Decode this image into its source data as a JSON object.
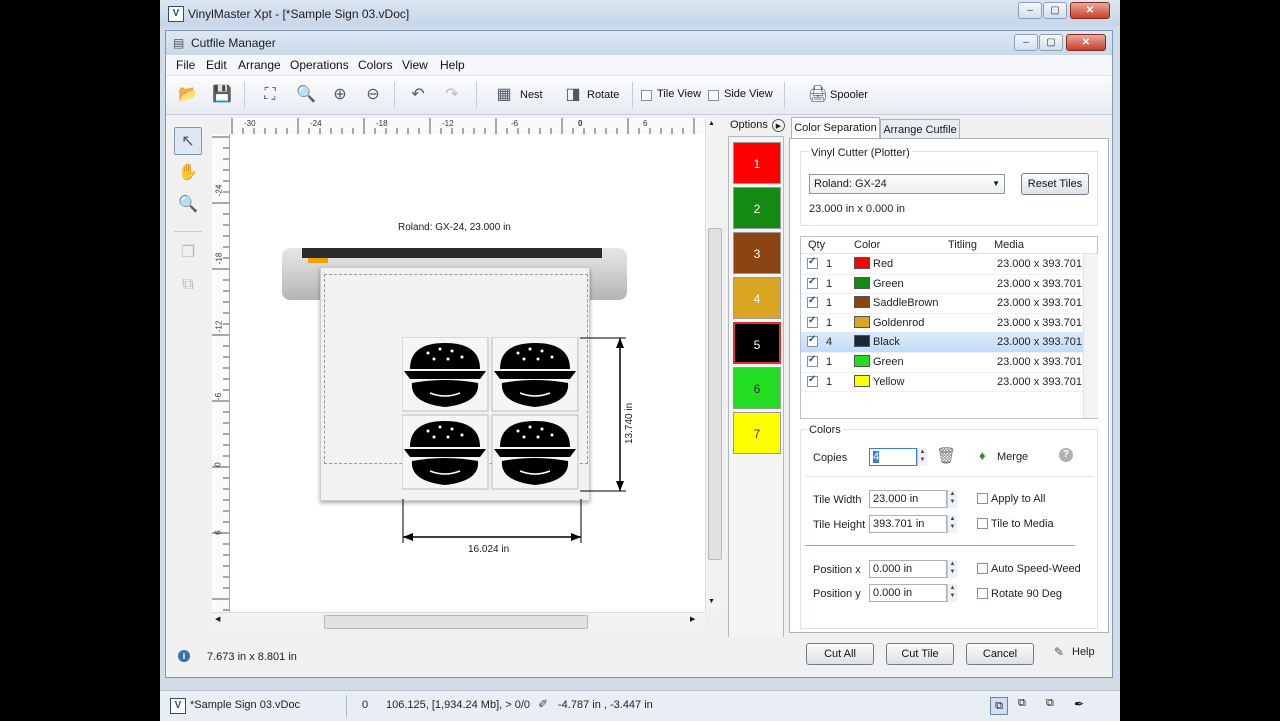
{
  "app": {
    "title": "VinylMaster Xpt - [*Sample Sign 03.vDoc]",
    "icon_letter": "V"
  },
  "dialog": {
    "title": "Cutfile Manager"
  },
  "menu": [
    "File",
    "Edit",
    "Arrange",
    "Operations",
    "Colors",
    "View",
    "Help"
  ],
  "toolbar": {
    "nest_label": "Nest",
    "rotate_label": "Rotate",
    "tile_view_label": "Tile View",
    "side_view_label": "Side View",
    "spooler_label": "Spooler"
  },
  "ruler": {
    "top": [
      "-30",
      "-24",
      "-18",
      "-12",
      "-6",
      "0",
      "6"
    ],
    "left": [
      "-24",
      "-18",
      "-12",
      "-6",
      "0",
      "6"
    ]
  },
  "canvas": {
    "plotter_label": "Roland: GX-24, 23.000 in",
    "height_dim": "13.740 in",
    "width_dim": "16.024 in"
  },
  "options_label": "Options",
  "swatches": [
    {
      "num": "1",
      "color": "#ff0000"
    },
    {
      "num": "2",
      "color": "#138a12"
    },
    {
      "num": "3",
      "color": "#8b4513"
    },
    {
      "num": "4",
      "color": "#daa520"
    },
    {
      "num": "5",
      "color": "#000000"
    },
    {
      "num": "6",
      "color": "#22dd22"
    },
    {
      "num": "7",
      "color": "#ffff00"
    }
  ],
  "tabs": {
    "color_sep": "Color Separation",
    "arrange": "Arrange Cutfile"
  },
  "vinyl": {
    "group_label": "Vinyl Cutter (Plotter)",
    "device": "Roland: GX-24",
    "reset_tiles": "Reset Tiles",
    "size": "23.000 in x 0.000 in"
  },
  "colors_table": {
    "headers": [
      "Qty",
      "Color",
      "Titling",
      "Media"
    ],
    "rows": [
      {
        "qty": "1",
        "name": "Red",
        "color": "#ff0000",
        "media": "23.000 x 393.701"
      },
      {
        "qty": "1",
        "name": "Green",
        "color": "#138a12",
        "media": "23.000 x 393.701"
      },
      {
        "qty": "1",
        "name": "SaddleBrown",
        "color": "#8b4513",
        "media": "23.000 x 393.701"
      },
      {
        "qty": "1",
        "name": "Goldenrod",
        "color": "#daa520",
        "media": "23.000 x 393.701"
      },
      {
        "qty": "4",
        "name": "Black",
        "color": "#1b2a3a",
        "media": "23.000 x 393.701"
      },
      {
        "qty": "1",
        "name": "Green",
        "color": "#22dd22",
        "media": "23.000 x 393.701"
      },
      {
        "qty": "1",
        "name": "Yellow",
        "color": "#ffff00",
        "media": "23.000 x 393.701"
      }
    ]
  },
  "colors_group": {
    "label": "Colors",
    "copies_label": "Copies",
    "copies_value": "4",
    "merge_label": "Merge"
  },
  "tile": {
    "width_label": "Tile Width",
    "width_value": "23.000 in",
    "height_label": "Tile Height",
    "height_value": "393.701 in",
    "apply_all": "Apply to All",
    "tile_media": "Tile to Media"
  },
  "position": {
    "x_label": "Position x",
    "x_value": "0.000 in",
    "y_label": "Position y",
    "y_value": "0.000 in",
    "auto_weed": "Auto Speed-Weed",
    "rotate90": "Rotate 90 Deg"
  },
  "buttons": {
    "cut_all": "Cut All",
    "cut_tile": "Cut Tile",
    "cancel": "Cancel",
    "help": "Help"
  },
  "dialog_status": "7.673 in x 8.801 in",
  "main_status": {
    "doc": "*Sample Sign 03.vDoc",
    "zero": "0",
    "mem": "106.125,  [1,934.24 Mb],  > 0/0",
    "coords": "-4.787 in , -3.447 in"
  }
}
